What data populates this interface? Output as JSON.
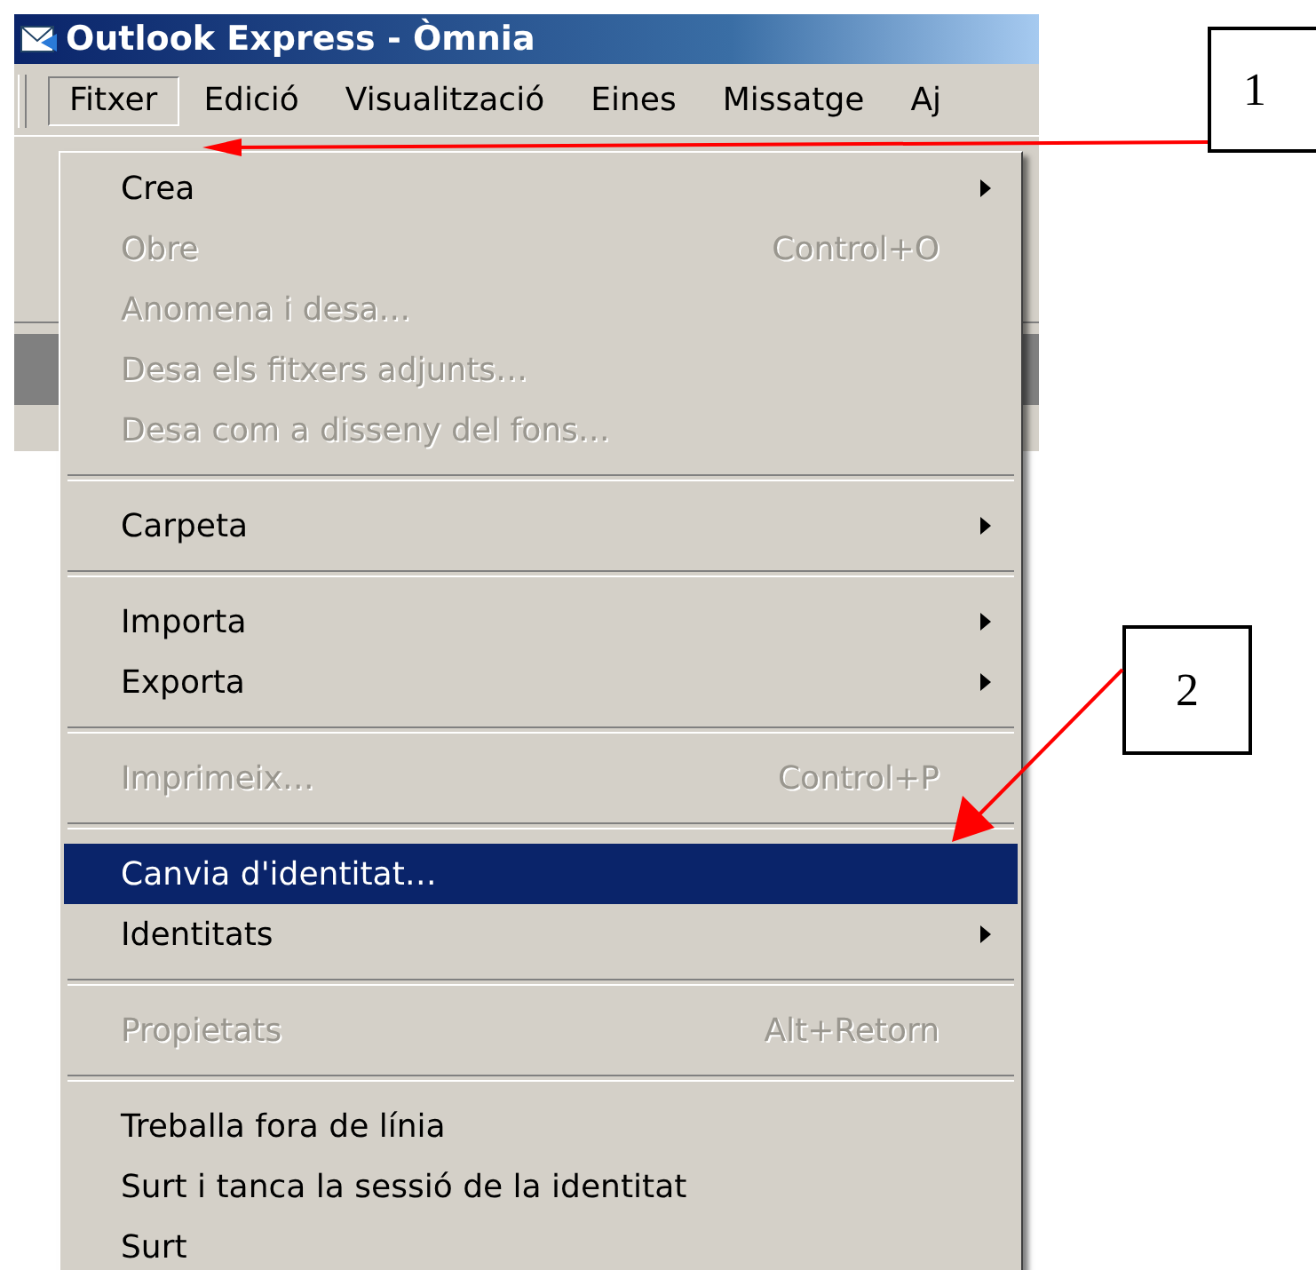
{
  "window": {
    "title": "Outlook Express - Òmnia"
  },
  "menu_bar": [
    {
      "label": "Fitxer",
      "selected": true
    },
    {
      "label": "Edició",
      "selected": false
    },
    {
      "label": "Visualització",
      "selected": false
    },
    {
      "label": "Eines",
      "selected": false
    },
    {
      "label": "Missatge",
      "selected": false
    },
    {
      "label": "Aj",
      "selected": false
    }
  ],
  "menu": [
    {
      "kind": "item",
      "label": "Crea",
      "disabled": false,
      "submenu": true,
      "selected": false
    },
    {
      "kind": "item",
      "label": "Obre",
      "shortcut": "Control+O",
      "disabled": true,
      "submenu": false,
      "selected": false
    },
    {
      "kind": "item",
      "label": "Anomena i desa…",
      "disabled": true,
      "submenu": false,
      "selected": false
    },
    {
      "kind": "item",
      "label": "Desa els fitxers adjunts…",
      "disabled": true,
      "submenu": false,
      "selected": false
    },
    {
      "kind": "item",
      "label": "Desa com a disseny del fons…",
      "disabled": true,
      "submenu": false,
      "selected": false
    },
    {
      "kind": "separator"
    },
    {
      "kind": "item",
      "label": "Carpeta",
      "disabled": false,
      "submenu": true,
      "selected": false
    },
    {
      "kind": "separator"
    },
    {
      "kind": "item",
      "label": "Importa",
      "disabled": false,
      "submenu": true,
      "selected": false
    },
    {
      "kind": "item",
      "label": "Exporta",
      "disabled": false,
      "submenu": true,
      "selected": false
    },
    {
      "kind": "separator"
    },
    {
      "kind": "item",
      "label": "Imprimeix…",
      "shortcut": "Control+P",
      "disabled": true,
      "submenu": false,
      "selected": false
    },
    {
      "kind": "separator"
    },
    {
      "kind": "item",
      "label": "Canvia d'identitat…",
      "disabled": false,
      "submenu": false,
      "selected": true
    },
    {
      "kind": "item",
      "label": "Identitats",
      "disabled": false,
      "submenu": true,
      "selected": false
    },
    {
      "kind": "separator"
    },
    {
      "kind": "item",
      "label": "Propietats",
      "shortcut": "Alt+Retorn",
      "disabled": true,
      "submenu": false,
      "selected": false
    },
    {
      "kind": "separator"
    },
    {
      "kind": "item",
      "label": "Treballa fora de línia",
      "disabled": false,
      "submenu": false,
      "selected": false
    },
    {
      "kind": "item",
      "label": "Surt i tanca la sessió de la identitat",
      "disabled": false,
      "submenu": false,
      "selected": false
    },
    {
      "kind": "item",
      "label": "Surt",
      "disabled": false,
      "submenu": false,
      "selected": false
    }
  ],
  "callouts": [
    {
      "label": "1"
    },
    {
      "label": "2"
    }
  ]
}
